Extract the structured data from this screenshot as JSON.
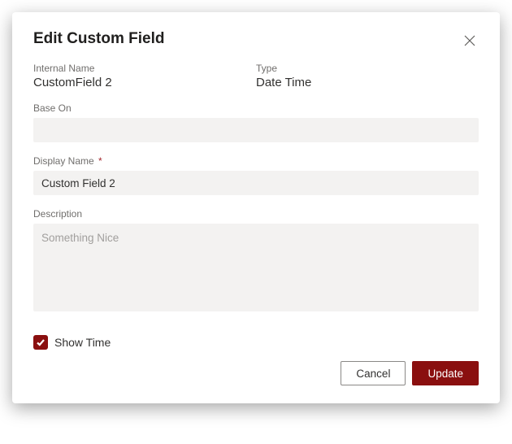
{
  "dialog": {
    "title": "Edit Custom Field",
    "internal_name_label": "Internal Name",
    "internal_name_value": "CustomField 2",
    "type_label": "Type",
    "type_value": "Date Time",
    "base_on_label": "Base On",
    "base_on_value": "",
    "display_name_label": "Display Name",
    "display_name_value": "Custom Field 2",
    "description_label": "Description",
    "description_value": "",
    "description_placeholder": "Something Nice",
    "show_time_label": "Show Time",
    "show_time_checked": true,
    "cancel_label": "Cancel",
    "update_label": "Update"
  }
}
